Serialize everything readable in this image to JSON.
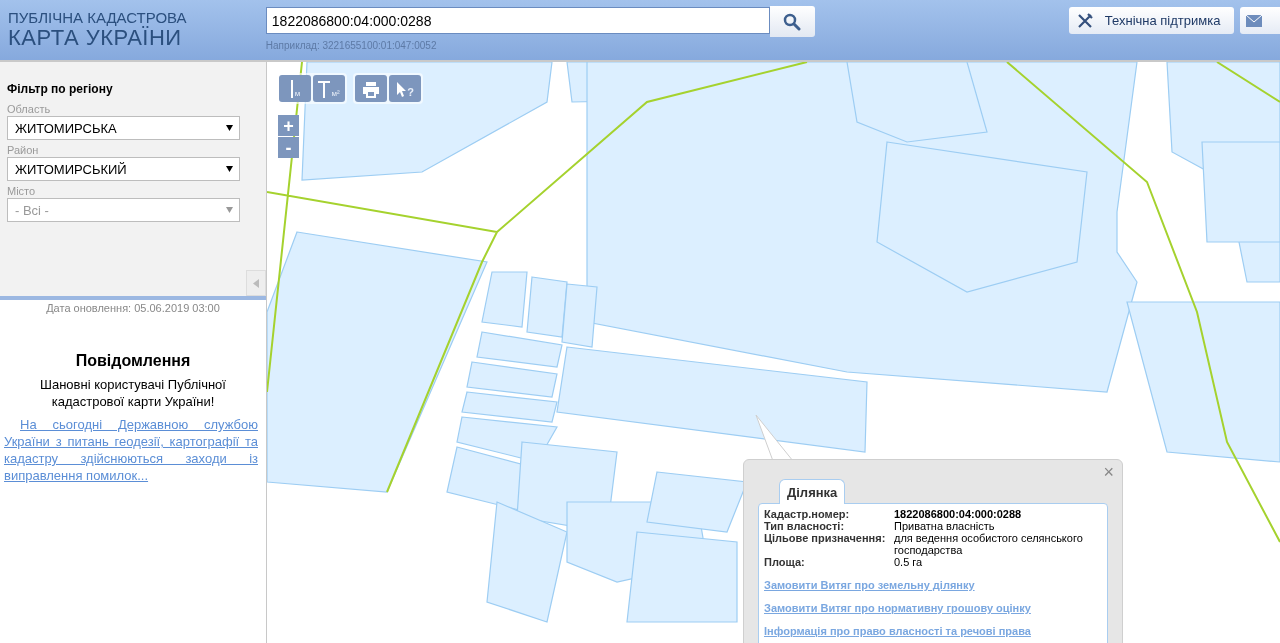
{
  "header": {
    "logo": [
      "ПУБЛІЧНА КАДАСТРОВА",
      "КАРТА УКРАЇНИ"
    ],
    "search": {
      "value": "1822086800:04:000:0288",
      "hint": "Наприклад: 3221655100:01:047:0052"
    },
    "support_button": "Технічна підтримка"
  },
  "filter": {
    "title": "Фільтр по регіону",
    "fields": [
      {
        "label": "Область",
        "value": "ЖИТОМИРСЬКА",
        "disabled": false
      },
      {
        "label": "Район",
        "value": "ЖИТОМИРСЬКИЙ",
        "disabled": false
      },
      {
        "label": "Місто",
        "value": "- Всі -",
        "disabled": true
      }
    ]
  },
  "update_date": "Дата оновлення: 05.06.2019 03:00",
  "notice": {
    "title": "Повідомлення",
    "greeting": "Шановні користувачі Публічної кадастрової карти України!",
    "link": "На сьогодні Державною службою України з питань геодезії, картографії та кадастру здійснюються заходи із виправлення помилок..."
  },
  "map_tools": [
    {
      "kind": "measure-line",
      "label": "м"
    },
    {
      "kind": "measure-area",
      "label": "м²"
    },
    {
      "kind": "print"
    },
    {
      "kind": "identify",
      "label": "?"
    }
  ],
  "zoom": [
    "+",
    "-"
  ],
  "popup": {
    "tab": "Ділянка",
    "close": "×",
    "rows": [
      {
        "label": "Кадастр.номер:",
        "value": "1822086800:04:000:0288",
        "bold": true
      },
      {
        "label": "Тип власності:",
        "value": "Приватна власність",
        "bold": false
      },
      {
        "label": "Цільове призначення:",
        "value": "для ведення особистого селянського господарства",
        "bold": false
      },
      {
        "label": "Площа:",
        "value": "0.5 га",
        "bold": false
      }
    ],
    "links": [
      "Замовити Витяг про земельну ділянку",
      "Замовити Витяг про нормативну грошову оцінку",
      "Інформація про право власності та речові права"
    ]
  }
}
